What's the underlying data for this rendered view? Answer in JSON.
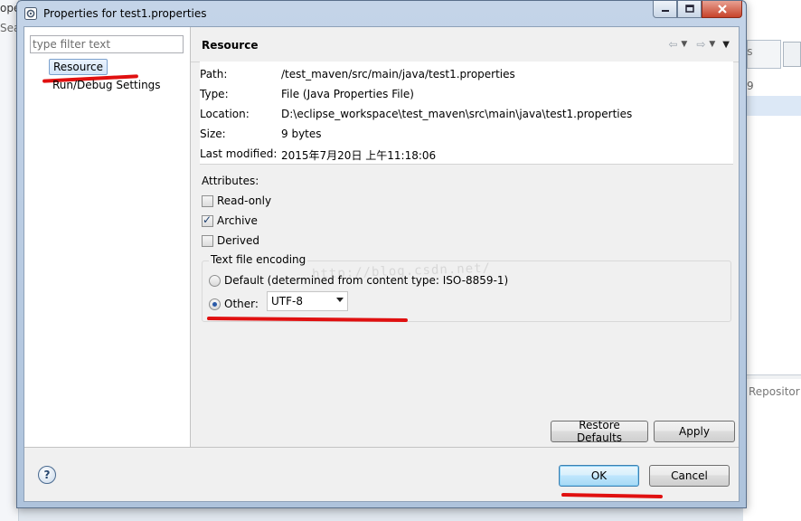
{
  "background": {
    "left_text_1": "ope",
    "left_text_2": "Sea",
    "right_text_ss": "ss",
    "right_text_9": "9",
    "right_text_repo": "Repositor"
  },
  "dialog": {
    "title": "Properties for test1.properties"
  },
  "filter": {
    "placeholder": "type filter text"
  },
  "tree": {
    "items": [
      {
        "label": "Resource",
        "selected": true
      },
      {
        "label": "Run/Debug Settings",
        "selected": false
      }
    ]
  },
  "page": {
    "title": "Resource",
    "info": [
      {
        "label": "Path:",
        "value": "/test_maven/src/main/java/test1.properties"
      },
      {
        "label": "Type:",
        "value": "File  (Java Properties File)"
      },
      {
        "label": "Location:",
        "value": "D:\\eclipse_workspace\\test_maven\\src\\main\\java\\test1.properties"
      },
      {
        "label": "Size:",
        "value": "9  bytes"
      },
      {
        "label": "Last modified:",
        "value": "2015年7月20日 上午11:18:06"
      }
    ],
    "attributes_label": "Attributes:",
    "attributes": [
      {
        "label": "Read-only",
        "checked": false
      },
      {
        "label": "Archive",
        "checked": true
      },
      {
        "label": "Derived",
        "checked": false
      }
    ],
    "encoding": {
      "group_label": "Text file encoding",
      "default_label": "Default (determined from content type: ISO-8859-1)",
      "other_label": "Other:",
      "selected": "other",
      "other_value": "UTF-8"
    },
    "watermark": "http://blog.csdn.net/",
    "restore_defaults_label": "Restore Defaults",
    "apply_label": "Apply"
  },
  "footer": {
    "help_label": "?",
    "ok_label": "OK",
    "cancel_label": "Cancel"
  },
  "colors": {
    "annotation_red": "#e01010",
    "selection": "#d3e5fa"
  }
}
